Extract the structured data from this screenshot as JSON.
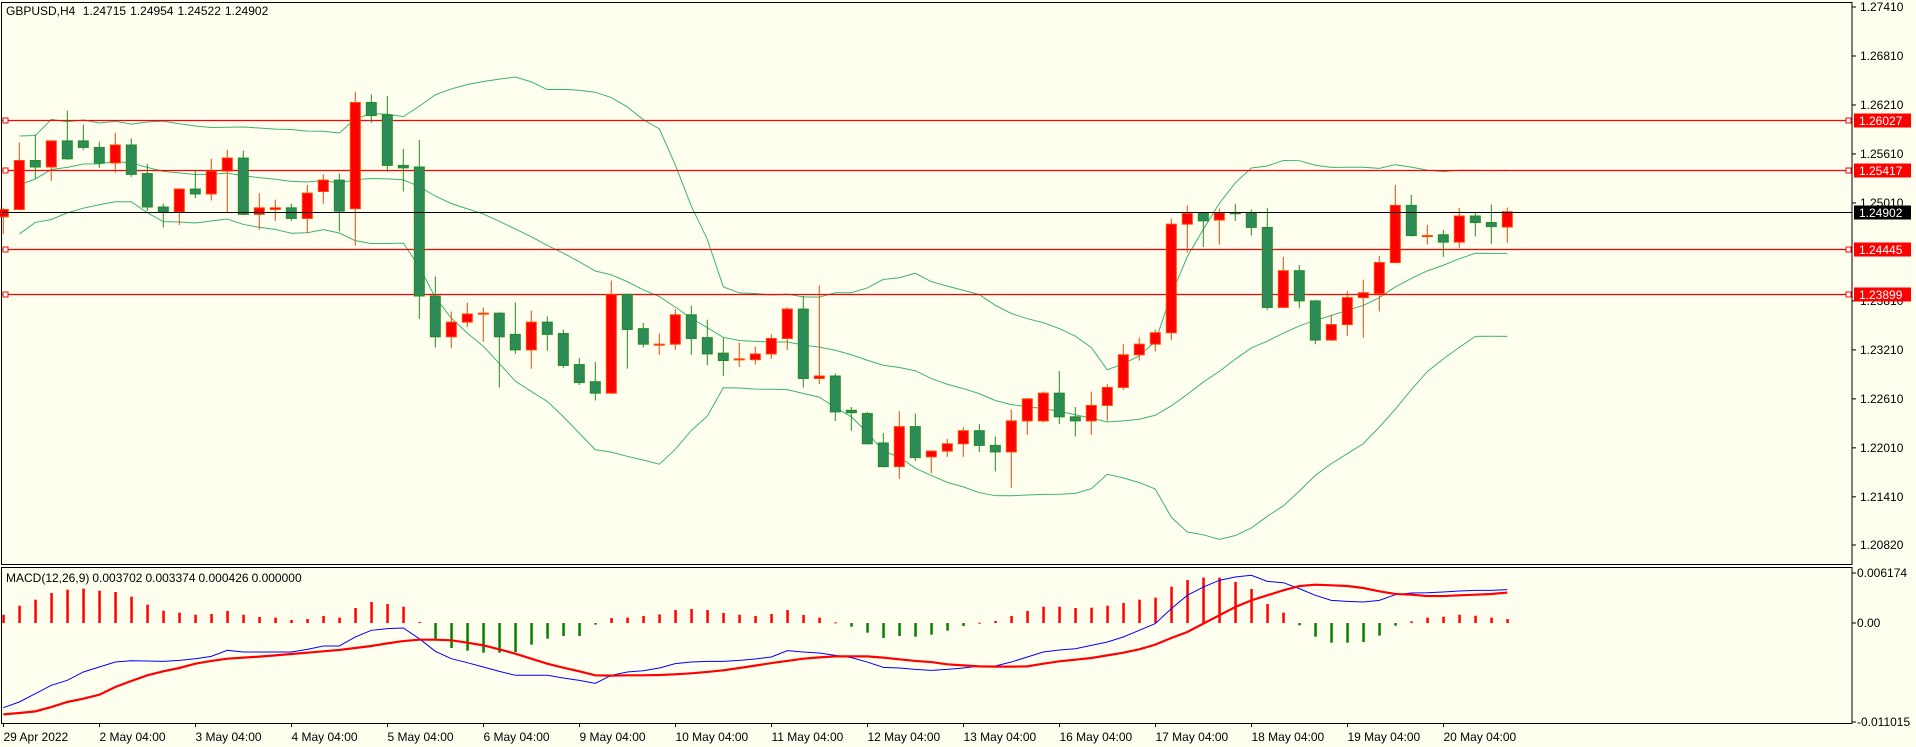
{
  "header": {
    "symbol": "GBPUSD,H4",
    "open": "1.24715",
    "high": "1.24954",
    "low": "1.24522",
    "close": "1.24902"
  },
  "macd_header": {
    "name": "MACD(12,26,9)",
    "v1": "0.003702",
    "v2": "0.003374",
    "v3": "0.000426",
    "v4": "0.000000"
  },
  "colors": {
    "background": "#fffff0",
    "bull": "#ff0000",
    "bull_border": "#ff4500",
    "bear": "#2e8b57",
    "bear_border": "#228b22",
    "bands": "#3cb371",
    "level_line": "#ff0000",
    "price_line": "#000000",
    "macd_line": "#0000ff",
    "signal_line": "#ff0000",
    "hist_pos": "#ff0000",
    "hist_neg": "#008000"
  },
  "chart_data": [
    {
      "type": "candlestick",
      "title": "GBPUSD,H4",
      "ylim": [
        1.2082,
        1.2741
      ],
      "y_ticks": [
        "1.27410",
        "1.26810",
        "1.26210",
        "1.25610",
        "1.25010",
        "1.23810",
        "1.23210",
        "1.22610",
        "1.22010",
        "1.21410",
        "1.20820"
      ],
      "x_labels": [
        {
          "bar": 0,
          "label": "29 Apr 2022"
        },
        {
          "bar": 6,
          "label": "2 May 04:00"
        },
        {
          "bar": 12,
          "label": "3 May 04:00"
        },
        {
          "bar": 18,
          "label": "4 May 04:00"
        },
        {
          "bar": 24,
          "label": "5 May 04:00"
        },
        {
          "bar": 30,
          "label": "6 May 04:00"
        },
        {
          "bar": 36,
          "label": "9 May 04:00"
        },
        {
          "bar": 42,
          "label": "10 May 04:00"
        },
        {
          "bar": 48,
          "label": "11 May 04:00"
        },
        {
          "bar": 54,
          "label": "12 May 04:00"
        },
        {
          "bar": 60,
          "label": "13 May 04:00"
        },
        {
          "bar": 66,
          "label": "16 May 04:00"
        },
        {
          "bar": 72,
          "label": "17 May 04:00"
        },
        {
          "bar": 78,
          "label": "18 May 04:00"
        },
        {
          "bar": 84,
          "label": "19 May 04:00"
        },
        {
          "bar": 90,
          "label": "20 May 04:00"
        }
      ],
      "levels": [
        "1.26027",
        "1.25417",
        "1.24445",
        "1.23899"
      ],
      "current_price": "1.24902",
      "bollinger": {
        "period": 20,
        "deviation": 2
      },
      "ohlc": [
        [
          1.2484,
          1.2495,
          1.2463,
          1.2493
        ],
        [
          1.2493,
          1.2575,
          1.2492,
          1.2553
        ],
        [
          1.2553,
          1.2585,
          1.2531,
          1.2545
        ],
        [
          1.2545,
          1.2578,
          1.2528,
          1.2577
        ],
        [
          1.2577,
          1.2614,
          1.2554,
          1.2555
        ],
        [
          1.2577,
          1.2597,
          1.2566,
          1.2569
        ],
        [
          1.2569,
          1.2576,
          1.2544,
          1.255
        ],
        [
          1.255,
          1.2587,
          1.2538,
          1.2572
        ],
        [
          1.2572,
          1.258,
          1.2533,
          1.2536
        ],
        [
          1.2537,
          1.2549,
          1.2491,
          1.2496
        ],
        [
          1.2496,
          1.25,
          1.2471,
          1.249
        ],
        [
          1.249,
          1.2519,
          1.2474,
          1.2518
        ],
        [
          1.2518,
          1.254,
          1.2507,
          1.2512
        ],
        [
          1.2512,
          1.2555,
          1.2504,
          1.254
        ],
        [
          1.254,
          1.2566,
          1.249,
          1.2556
        ],
        [
          1.2556,
          1.2565,
          1.2486,
          1.2487
        ],
        [
          1.2487,
          1.2513,
          1.2468,
          1.2495
        ],
        [
          1.2493,
          1.2505,
          1.2479,
          1.2495
        ],
        [
          1.2495,
          1.25,
          1.2479,
          1.2482
        ],
        [
          1.2482,
          1.2523,
          1.2464,
          1.2513
        ],
        [
          1.2515,
          1.2536,
          1.25,
          1.2529
        ],
        [
          1.2529,
          1.2537,
          1.2466,
          1.2491
        ],
        [
          1.2494,
          1.2637,
          1.2449,
          1.2624
        ],
        [
          1.2624,
          1.2634,
          1.2599,
          1.2608
        ],
        [
          1.2609,
          1.2632,
          1.2539,
          1.2547
        ],
        [
          1.2547,
          1.2567,
          1.2515,
          1.2544
        ],
        [
          1.2545,
          1.2578,
          1.2359,
          1.2387
        ],
        [
          1.2387,
          1.2411,
          1.2324,
          1.2337
        ],
        [
          1.2337,
          1.2368,
          1.2323,
          1.2355
        ],
        [
          1.2355,
          1.2379,
          1.2349,
          1.2365
        ],
        [
          1.2365,
          1.2373,
          1.2331,
          1.2366
        ],
        [
          1.2366,
          1.2367,
          1.2275,
          1.2337
        ],
        [
          1.234,
          1.2379,
          1.2316,
          1.2321
        ],
        [
          1.2321,
          1.2369,
          1.2298,
          1.2355
        ],
        [
          1.2355,
          1.2362,
          1.232,
          1.234
        ],
        [
          1.2341,
          1.2346,
          1.2299,
          1.2302
        ],
        [
          1.2303,
          1.2311,
          1.2278,
          1.2281
        ],
        [
          1.2282,
          1.2306,
          1.2259,
          1.2268
        ],
        [
          1.2268,
          1.2406,
          1.2267,
          1.2389
        ],
        [
          1.2389,
          1.239,
          1.2298,
          1.2346
        ],
        [
          1.2347,
          1.2354,
          1.2324,
          1.2328
        ],
        [
          1.2327,
          1.2341,
          1.2315,
          1.2328
        ],
        [
          1.2328,
          1.2371,
          1.2321,
          1.2364
        ],
        [
          1.2364,
          1.2375,
          1.2315,
          1.2335
        ],
        [
          1.2336,
          1.2358,
          1.2302,
          1.2316
        ],
        [
          1.2317,
          1.2336,
          1.2289,
          1.2308
        ],
        [
          1.2309,
          1.233,
          1.23,
          1.231
        ],
        [
          1.2309,
          1.2325,
          1.2303,
          1.2316
        ],
        [
          1.2316,
          1.234,
          1.231,
          1.2335
        ],
        [
          1.2335,
          1.2373,
          1.2321,
          1.2371
        ],
        [
          1.2371,
          1.2387,
          1.2275,
          1.2286
        ],
        [
          1.2286,
          1.24,
          1.2279,
          1.2289
        ],
        [
          1.2289,
          1.2292,
          1.2234,
          1.2245
        ],
        [
          1.2247,
          1.2251,
          1.2222,
          1.2244
        ],
        [
          1.2243,
          1.2245,
          1.2205,
          1.2206
        ],
        [
          1.2207,
          1.2219,
          1.2177,
          1.2178
        ],
        [
          1.2178,
          1.2246,
          1.2163,
          1.2227
        ],
        [
          1.2227,
          1.2243,
          1.2185,
          1.2189
        ],
        [
          1.219,
          1.2198,
          1.217,
          1.2197
        ],
        [
          1.2197,
          1.2212,
          1.219,
          1.2206
        ],
        [
          1.2206,
          1.2226,
          1.219,
          1.2222
        ],
        [
          1.2222,
          1.223,
          1.2196,
          1.2204
        ],
        [
          1.2204,
          1.2215,
          1.2172,
          1.2196
        ],
        [
          1.2196,
          1.2248,
          1.2152,
          1.2234
        ],
        [
          1.2234,
          1.2262,
          1.2217,
          1.2261
        ],
        [
          1.2234,
          1.227,
          1.2232,
          1.2268
        ],
        [
          1.2268,
          1.2295,
          1.223,
          1.2239
        ],
        [
          1.2239,
          1.2251,
          1.2215,
          1.2234
        ],
        [
          1.2234,
          1.227,
          1.2217,
          1.2253
        ],
        [
          1.2253,
          1.2279,
          1.2234,
          1.2275
        ],
        [
          1.2275,
          1.2328,
          1.2272,
          1.2315
        ],
        [
          1.2315,
          1.2336,
          1.2308,
          1.2328
        ],
        [
          1.2328,
          1.2346,
          1.2319,
          1.2342
        ],
        [
          1.2342,
          1.2482,
          1.2333,
          1.2475
        ],
        [
          1.2475,
          1.2498,
          1.244,
          1.2488
        ],
        [
          1.2488,
          1.2488,
          1.2447,
          1.2479
        ],
        [
          1.248,
          1.2494,
          1.245,
          1.2489
        ],
        [
          1.2489,
          1.25,
          1.2479,
          1.2488
        ],
        [
          1.2488,
          1.2493,
          1.2461,
          1.2471
        ],
        [
          1.2471,
          1.2495,
          1.237,
          1.2373
        ],
        [
          1.2373,
          1.2435,
          1.2372,
          1.2418
        ],
        [
          1.2418,
          1.2425,
          1.2372,
          1.2381
        ],
        [
          1.2381,
          1.2382,
          1.2328,
          1.2333
        ],
        [
          1.2333,
          1.2364,
          1.2332,
          1.2352
        ],
        [
          1.2352,
          1.2393,
          1.2338,
          1.2385
        ],
        [
          1.2385,
          1.2407,
          1.2336,
          1.2391
        ],
        [
          1.239,
          1.2436,
          1.2368,
          1.2428
        ],
        [
          1.2428,
          1.2523,
          1.2427,
          1.2498
        ],
        [
          1.2498,
          1.2511,
          1.246,
          1.2461
        ],
        [
          1.246,
          1.2474,
          1.245,
          1.2461
        ],
        [
          1.2462,
          1.2468,
          1.2435,
          1.2453
        ],
        [
          1.2453,
          1.2495,
          1.2446,
          1.2485
        ],
        [
          1.2485,
          1.249,
          1.246,
          1.2477
        ],
        [
          1.2477,
          1.2499,
          1.2451,
          1.2472
        ],
        [
          1.24715,
          1.24954,
          1.24522,
          1.24902
        ]
      ]
    },
    {
      "type": "bar+line",
      "title": "MACD(12,26,9)",
      "ylim": [
        -0.011015,
        0.006174
      ],
      "y_ticks": [
        "0.006174",
        "0.00",
        "-0.011015"
      ],
      "histogram": [
        0.00092,
        0.00192,
        0.00259,
        0.00333,
        0.0037,
        0.00381,
        0.00359,
        0.00344,
        0.00292,
        0.00203,
        0.00137,
        0.00115,
        0.00092,
        0.001,
        0.00133,
        0.00092,
        0.00067,
        0.00059,
        0.00033,
        0.00044,
        0.00078,
        0.00059,
        0.00166,
        0.00233,
        0.00211,
        0.00181,
        0.00011,
        -0.00174,
        -0.00277,
        -0.00307,
        -0.00329,
        -0.00329,
        -0.00322,
        -0.0024,
        -0.00174,
        -0.00144,
        -0.00144,
        -0.00018,
        0.00055,
        0.0006,
        0.00078,
        0.00096,
        0.00144,
        0.00155,
        0.00144,
        0.00111,
        0.00092,
        0.00078,
        0.001,
        0.00144,
        0.00089,
        0.00059,
        7e-05,
        -0.00041,
        -0.00107,
        -0.00166,
        -0.00144,
        -0.00152,
        -0.00129,
        -0.00085,
        -0.00033,
        4e-05,
        0.00022,
        0.00078,
        0.00133,
        0.00181,
        0.00181,
        0.00166,
        0.0017,
        0.00192,
        0.00222,
        0.00259,
        0.00281,
        0.00403,
        0.00477,
        0.00503,
        0.00503,
        0.00455,
        0.00377,
        0.00211,
        0.00115,
        -0.00026,
        -0.00152,
        -0.00218,
        -0.00218,
        -0.00211,
        -0.0014,
        -0.0003,
        0.00018,
        0.00059,
        0.0007,
        0.00092,
        0.00081,
        0.00059,
        0.000426
      ],
      "blue_line": [
        -0.00939,
        -0.00876,
        -0.00784,
        -0.00691,
        -0.00636,
        -0.00543,
        -0.00488,
        -0.00433,
        -0.00418,
        -0.00421,
        -0.00425,
        -0.00414,
        -0.00396,
        -0.0037,
        -0.00303,
        -0.00322,
        -0.00322,
        -0.00322,
        -0.00322,
        -0.00292,
        -0.00255,
        -0.00255,
        -0.00155,
        -0.00081,
        -0.00063,
        -0.00055,
        -0.00174,
        -0.00314,
        -0.00396,
        -0.0044,
        -0.00488,
        -0.00536,
        -0.0058,
        -0.0058,
        -0.0058,
        -0.0061,
        -0.00636,
        -0.00669,
        -0.0058,
        -0.00543,
        -0.00529,
        -0.00499,
        -0.00451,
        -0.00433,
        -0.00425,
        -0.00425,
        -0.00414,
        -0.00399,
        -0.00377,
        -0.00307,
        -0.00322,
        -0.00333,
        -0.00359,
        -0.00384,
        -0.00433,
        -0.00492,
        -0.00499,
        -0.00514,
        -0.00525,
        -0.00514,
        -0.00499,
        -0.00477,
        -0.00477,
        -0.00433,
        -0.00377,
        -0.00322,
        -0.00299,
        -0.00285,
        -0.00248,
        -0.00211,
        -0.00155,
        -0.00081,
        -7e-05,
        0.00159,
        0.00307,
        0.00399,
        0.00473,
        0.0051,
        0.00529,
        0.00462,
        0.00447,
        0.00381,
        0.00307,
        0.00251,
        0.0024,
        0.00233,
        0.00251,
        0.00314,
        0.00333,
        0.00336,
        0.00344,
        0.00355,
        0.00362,
        0.00362,
        0.003702
      ],
      "red_line": [
        -0.01013,
        -0.00998,
        -0.0098,
        -0.00932,
        -0.00876,
        -0.00839,
        -0.00795,
        -0.0071,
        -0.00643,
        -0.0058,
        -0.00536,
        -0.00499,
        -0.00451,
        -0.00421,
        -0.00396,
        -0.00384,
        -0.00373,
        -0.00359,
        -0.00344,
        -0.00329,
        -0.00314,
        -0.00299,
        -0.00277,
        -0.00255,
        -0.00226,
        -0.002,
        -0.00185,
        -0.00185,
        -0.00192,
        -0.00218,
        -0.00248,
        -0.00292,
        -0.0034,
        -0.00396,
        -0.00451,
        -0.00495,
        -0.00536,
        -0.0058,
        -0.00584,
        -0.0058,
        -0.0058,
        -0.00577,
        -0.00569,
        -0.00558,
        -0.00543,
        -0.00525,
        -0.00499,
        -0.00473,
        -0.00444,
        -0.00421,
        -0.00396,
        -0.00381,
        -0.0037,
        -0.0037,
        -0.0037,
        -0.00384,
        -0.00403,
        -0.00421,
        -0.00433,
        -0.00458,
        -0.0047,
        -0.00481,
        -0.00484,
        -0.00484,
        -0.00481,
        -0.00451,
        -0.00425,
        -0.00407,
        -0.00388,
        -0.00359,
        -0.00329,
        -0.00292,
        -0.0024,
        -0.00166,
        -0.001,
        -7e-05,
        0.00085,
        0.00177,
        0.00251,
        0.00307,
        0.00362,
        0.0041,
        0.00425,
        0.00418,
        0.0041,
        0.00388,
        0.00351,
        0.00322,
        0.00314,
        0.00299,
        0.00299,
        0.00307,
        0.00314,
        0.00322,
        0.003374
      ]
    }
  ]
}
